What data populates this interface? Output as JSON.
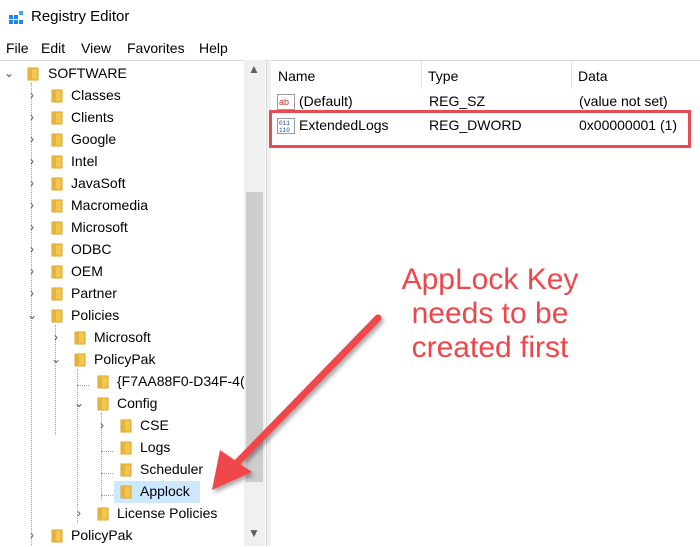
{
  "window": {
    "title": "Registry Editor"
  },
  "menu": [
    "File",
    "Edit",
    "View",
    "Favorites",
    "Help"
  ],
  "tree": {
    "software": "SOFTWARE",
    "classes": "Classes",
    "clients": "Clients",
    "google": "Google",
    "intel": "Intel",
    "javasoft": "JavaSoft",
    "macromedia": "Macromedia",
    "microsoft": "Microsoft",
    "odbc": "ODBC",
    "oem": "OEM",
    "partner": "Partner",
    "policies": "Policies",
    "pol_microsoft": "Microsoft",
    "policypak": "PolicyPak",
    "guid": "{F7AA88F0-D34F-4(",
    "config": "Config",
    "cse": "CSE",
    "logs": "Logs",
    "scheduler": "Scheduler",
    "applock": "Applock",
    "license": "License Policies",
    "policypak2": "PolicyPak"
  },
  "list": {
    "headers": {
      "name": "Name",
      "type": "Type",
      "data": "Data"
    },
    "rows": [
      {
        "name": "(Default)",
        "type": "REG_SZ",
        "data": "(value not set)",
        "icon": "string-value-icon"
      },
      {
        "name": "ExtendedLogs",
        "type": "REG_DWORD",
        "data": "0x00000001 (1)",
        "icon": "dword-value-icon"
      }
    ]
  },
  "annotation": {
    "line1": "AppLock Key",
    "line2": "needs to be",
    "line3": "created first",
    "color": "#f0464b"
  }
}
